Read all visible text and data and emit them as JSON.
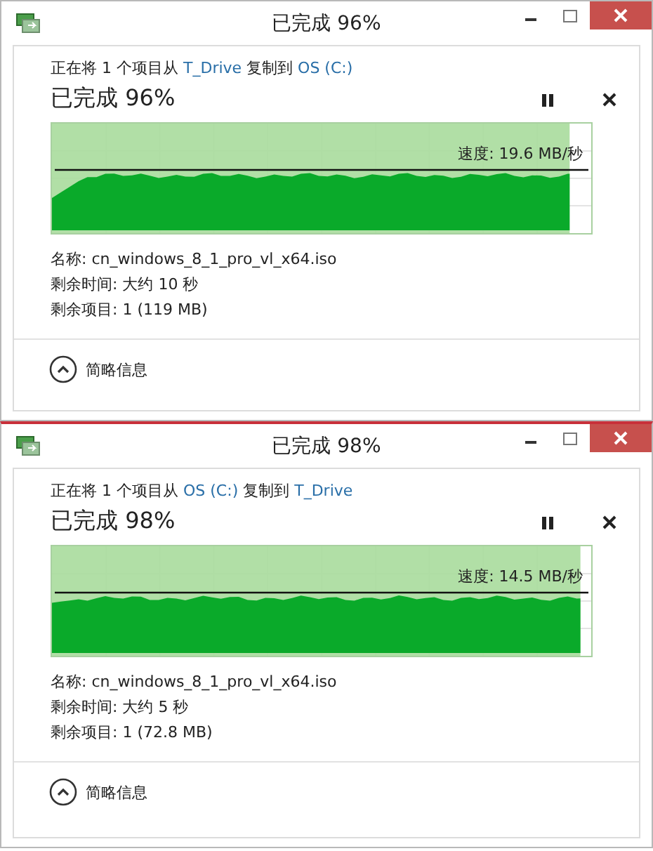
{
  "dialogs": [
    {
      "title": "已完成 96%",
      "header": {
        "prefix": "正在将 1 个项目从",
        "source": "T_Drive",
        "middle": "复制到",
        "destination": "OS (C:)"
      },
      "status": "已完成 96%",
      "level": 0.96,
      "speed": "速度: 19.6 MB/秒",
      "details": [
        "名称: cn_windows_8_1_pro_vl_x64.iso",
        "剩余时间: 大约 10 秒",
        "剩余项目: 1 (119 MB)"
      ],
      "toggle": "简略信息"
    },
    {
      "title": "已完成 98%",
      "header": {
        "prefix": "正在将 1 个项目从",
        "source": "OS (C:)",
        "middle": "复制到",
        "destination": "T_Drive"
      },
      "status": "已完成 98%",
      "level": 0.98,
      "speed": "速度: 14.5 MB/秒",
      "details": [
        "名称: cn_windows_8_1_pro_vl_x64.iso",
        "剩余时间: 大约 5 秒",
        "剩余项目: 1 (72.8 MB)"
      ],
      "toggle": "简略信息"
    }
  ]
}
